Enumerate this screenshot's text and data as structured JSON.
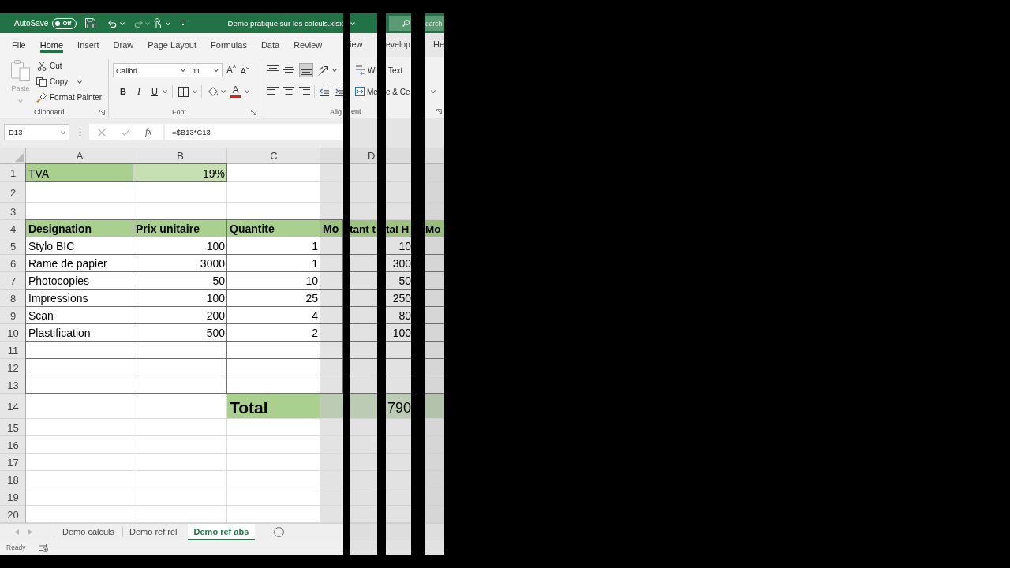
{
  "title_bar": {
    "autosave_label": "AutoSave",
    "autosave": {
      "label": "Off",
      "on": false
    },
    "title": "Demo pratique sur les calculs.xlsx"
  },
  "ribbon_tabs": [
    {
      "label": "File",
      "selected": false
    },
    {
      "label": "Home",
      "selected": true
    },
    {
      "label": "Insert",
      "selected": false
    },
    {
      "label": "Draw",
      "selected": false
    },
    {
      "label": "Page Layout",
      "selected": false
    },
    {
      "label": "Formulas",
      "selected": false
    },
    {
      "label": "Data",
      "selected": false
    },
    {
      "label": "Review",
      "selected": false
    }
  ],
  "clipboard": {
    "paste": "Paste",
    "cut": "Cut",
    "copy": "Copy",
    "format_painter": "Format Painter",
    "label": "Clipboard"
  },
  "font": {
    "name": "Calibri",
    "size": "11",
    "grow": "A",
    "shrink": "A",
    "bold": "B",
    "italic": "I",
    "underline": "U",
    "font_color": "A",
    "label": "Font"
  },
  "alignment": {
    "vertical": [
      {
        "selected": false
      },
      {
        "selected": false
      },
      {
        "selected": true
      }
    ],
    "horizontal": [
      {
        "selected": false
      },
      {
        "selected": false
      },
      {
        "selected": false
      }
    ],
    "label": "Alig"
  },
  "formula_bar": {
    "name_box": "D13",
    "function_button": "fx",
    "formula": "=$B13*C13"
  },
  "sheet": {
    "columns": [
      "A",
      "B",
      "C"
    ],
    "rows": [
      {
        "number": "1",
        "cells": [
          {
            "kind": "label_fill",
            "text": "TVA"
          },
          {
            "kind": "value_fill",
            "text": "19%"
          },
          {
            "kind": "blank"
          },
          {
            "kind": "blank"
          }
        ]
      },
      {
        "number": "2"
      },
      {
        "number": "3"
      },
      {
        "number": "4",
        "cells": [
          {
            "kind": "header",
            "text": "Designation"
          },
          {
            "kind": "header",
            "text": "Prix unitaire"
          },
          {
            "kind": "header",
            "text": "Quantite"
          },
          {
            "kind": "header",
            "text": "Mo"
          }
        ]
      },
      {
        "number": "5",
        "cells": [
          {
            "kind": "text",
            "text": "Stylo BIC"
          },
          {
            "kind": "number",
            "text": "100"
          },
          {
            "kind": "number",
            "text": "1"
          },
          {
            "kind": "boxed"
          }
        ]
      },
      {
        "number": "6",
        "cells": [
          {
            "kind": "text",
            "text": "Rame de papier"
          },
          {
            "kind": "number",
            "text": "3000"
          },
          {
            "kind": "number",
            "text": "1"
          },
          {
            "kind": "boxed"
          }
        ]
      },
      {
        "number": "7",
        "cells": [
          {
            "kind": "text",
            "text": "Photocopies"
          },
          {
            "kind": "number",
            "text": "50"
          },
          {
            "kind": "number",
            "text": "10"
          },
          {
            "kind": "boxed"
          }
        ]
      },
      {
        "number": "8",
        "cells": [
          {
            "kind": "text",
            "text": "Impressions"
          },
          {
            "kind": "number",
            "text": "100"
          },
          {
            "kind": "number",
            "text": "25"
          },
          {
            "kind": "boxed"
          }
        ]
      },
      {
        "number": "9",
        "cells": [
          {
            "kind": "text",
            "text": "Scan"
          },
          {
            "kind": "number",
            "text": "200"
          },
          {
            "kind": "number",
            "text": "4"
          },
          {
            "kind": "boxed"
          }
        ]
      },
      {
        "number": "10",
        "cells": [
          {
            "kind": "text",
            "text": "Plastification"
          },
          {
            "kind": "number",
            "text": "500"
          },
          {
            "kind": "number",
            "text": "2"
          },
          {
            "kind": "boxed"
          }
        ]
      },
      {
        "number": "11",
        "cells": [
          {
            "kind": "boxed"
          },
          {
            "kind": "boxed"
          },
          {
            "kind": "boxed"
          },
          {
            "kind": "boxed"
          }
        ]
      },
      {
        "number": "12",
        "cells": [
          {
            "kind": "boxed"
          },
          {
            "kind": "boxed"
          },
          {
            "kind": "boxed"
          },
          {
            "kind": "boxed"
          }
        ]
      },
      {
        "number": "13",
        "cells": [
          {
            "kind": "boxed"
          },
          {
            "kind": "boxed"
          },
          {
            "kind": "boxed"
          },
          {
            "kind": "boxed"
          }
        ]
      },
      {
        "number": "14",
        "cells": [
          {
            "kind": "blank"
          },
          {
            "kind": "blank"
          },
          {
            "kind": "total",
            "text": "Total"
          },
          {
            "kind": "total"
          }
        ]
      },
      {
        "number": "15"
      },
      {
        "number": "16"
      },
      {
        "number": "17"
      },
      {
        "number": "18"
      },
      {
        "number": "19"
      },
      {
        "number": "20"
      }
    ]
  },
  "slices": [
    {
      "ribbon_tab": "iew",
      "wrap_text": "Wr",
      "merge_center": "Me",
      "group_label": "ent",
      "column_header": "D",
      "header_cell": "tant t"
    },
    {
      "ribbon_tab": "evelop",
      "wrap_text": "Text",
      "merge_center": "e & Ce",
      "header_cell": "tal H",
      "values": [
        "10",
        "300",
        "50",
        "250",
        "80",
        "100"
      ],
      "total": "790"
    },
    {
      "search_field": {
        "placeholder": "earch"
      },
      "ribbon_tab": "He",
      "header_cell": "Mo"
    }
  ],
  "sheet_tabs": [
    {
      "label": "Demo calculs",
      "selected": false
    },
    {
      "label": "Demo ref rel",
      "selected": false
    },
    {
      "label": "Demo ref abs",
      "selected": true
    }
  ],
  "status_bar": {
    "text": "Ready"
  }
}
